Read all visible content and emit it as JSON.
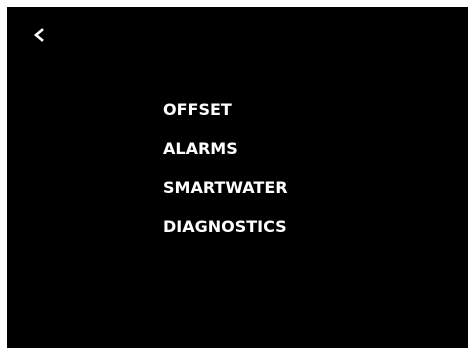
{
  "nav": {
    "back_icon": "chevron-left-icon"
  },
  "menu": {
    "items": [
      {
        "label": "OFFSET"
      },
      {
        "label": "ALARMS"
      },
      {
        "label": "SMARTWATER"
      },
      {
        "label": "DIAGNOSTICS"
      }
    ]
  },
  "colors": {
    "background": "#000000",
    "text": "#ffffff",
    "frame": "#ffffff"
  }
}
